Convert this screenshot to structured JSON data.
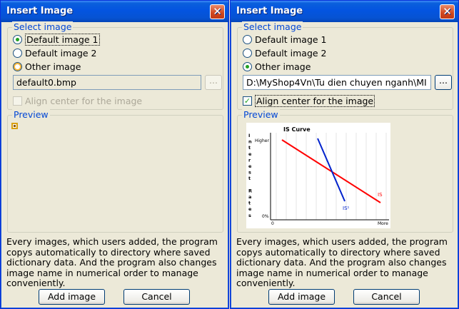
{
  "dialogs": [
    {
      "title": "Insert Image",
      "close_glyph": "✕",
      "select_group_label": "Select image",
      "radio_default1": "Default image 1",
      "radio_default2": "Default image 2",
      "radio_other": "Other image",
      "path_value": "default0.bmp",
      "browse_label": "...",
      "align_label": "Align center for the image",
      "preview_label": "Preview",
      "info_text": "Every images, which users added, the program copys automatically to directory where saved dictionary data. And the program also changes image name in numerical order to manage conveniently.",
      "add_button": "Add image",
      "cancel_button": "Cancel"
    },
    {
      "title": "Insert Image",
      "close_glyph": "✕",
      "select_group_label": "Select image",
      "radio_default1": "Default image 1",
      "radio_default2": "Default image 2",
      "radio_other": "Other image",
      "path_value": "D:\\MyShop4Vn\\Tu dien chuyen nganh\\MI",
      "browse_label": "...",
      "align_label": "Align center for the image",
      "align_check": "✓",
      "preview_label": "Preview",
      "info_text": "Every images, which users added, the program copys automatically to directory where saved dictionary data. And the program also changes image name in numerical order to manage conveniently.",
      "add_button": "Add image",
      "cancel_button": "Cancel"
    }
  ],
  "preview_chart": {
    "title": "IS Curve",
    "y_axis_letters": [
      "I",
      "n",
      "t",
      "e",
      "r",
      "e",
      "s",
      "t",
      "",
      "R",
      "a",
      "t",
      "e",
      "s"
    ],
    "y_top_label": "Higher",
    "y_bottom_label": "0%",
    "x_left_label": "0",
    "x_right_label": "More",
    "is_label": "IS",
    "is1_label": "IS¹",
    "is_color": "#ff0000",
    "is1_color": "#0022cc"
  },
  "colors": {
    "title_bar": "#0454e0",
    "group_label": "#0046d5",
    "dialog_bg": "#ece9d8"
  }
}
